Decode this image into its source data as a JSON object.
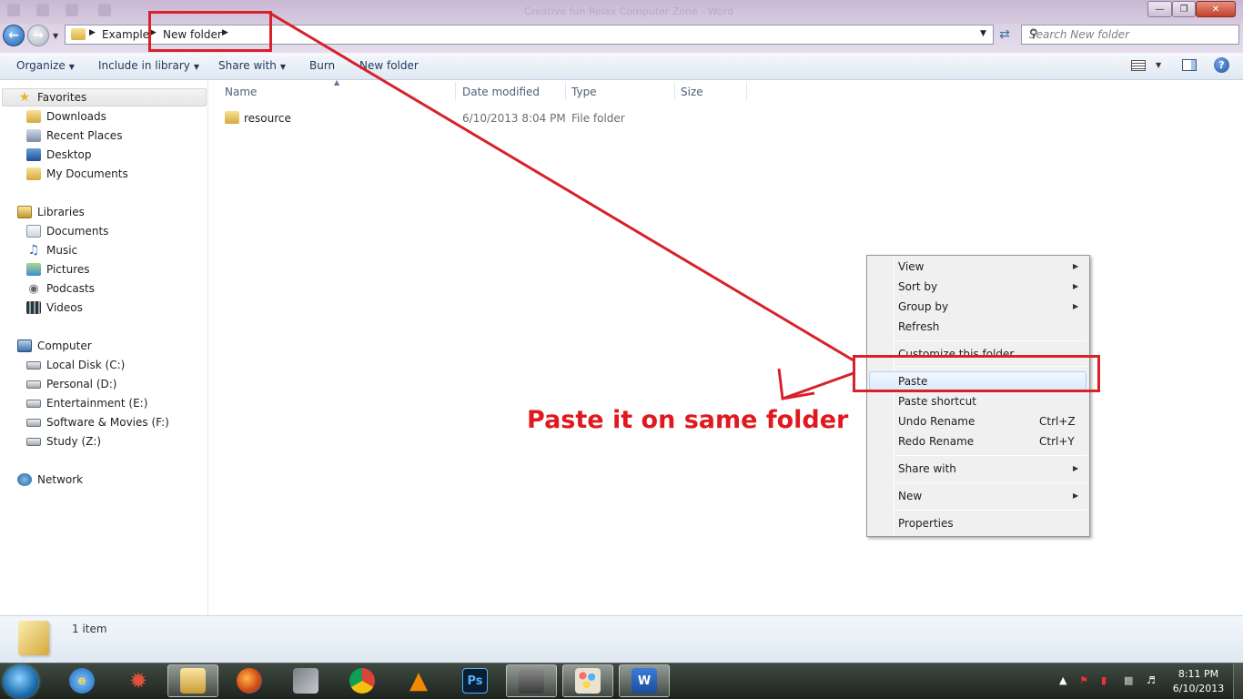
{
  "window": {
    "title": "Creative fun Relax Computer Zone - Word"
  },
  "address": {
    "crumbs": [
      "Example",
      "New folder"
    ],
    "search_placeholder": "Search New folder"
  },
  "toolbar": {
    "organize": "Organize",
    "include": "Include in library",
    "share": "Share with",
    "burn": "Burn",
    "new_folder": "New folder"
  },
  "nav": {
    "favorites": {
      "label": "Favorites",
      "items": [
        "Downloads",
        "Recent Places",
        "Desktop",
        "My Documents"
      ]
    },
    "libraries": {
      "label": "Libraries",
      "items": [
        "Documents",
        "Music",
        "Pictures",
        "Podcasts",
        "Videos"
      ]
    },
    "computer": {
      "label": "Computer",
      "items": [
        "Local Disk (C:)",
        "Personal (D:)",
        "Entertainment (E:)",
        "Software & Movies (F:)",
        "Study (Z:)"
      ]
    },
    "network": {
      "label": "Network"
    }
  },
  "columns": [
    "Name",
    "Date modified",
    "Type",
    "Size"
  ],
  "files": [
    {
      "name": "resource",
      "date": "6/10/2013 8:04 PM",
      "type": "File folder",
      "size": ""
    }
  ],
  "details": {
    "count": "1 item"
  },
  "context_menu": {
    "view": "View",
    "sort_by": "Sort by",
    "group_by": "Group by",
    "refresh": "Refresh",
    "customize": "Customize this folder",
    "paste": "Paste",
    "paste_shortcut": "Paste shortcut",
    "undo": "Undo Rename",
    "undo_sc": "Ctrl+Z",
    "redo": "Redo Rename",
    "redo_sc": "Ctrl+Y",
    "share": "Share with",
    "new": "New",
    "properties": "Properties"
  },
  "annotation": {
    "text": "Paste it on same folder",
    "color": "#e0191f"
  },
  "taskbar": {
    "ps_label": "Ps",
    "word_label": "W"
  },
  "clock": {
    "time": "8:11 PM",
    "date": "6/10/2013"
  }
}
